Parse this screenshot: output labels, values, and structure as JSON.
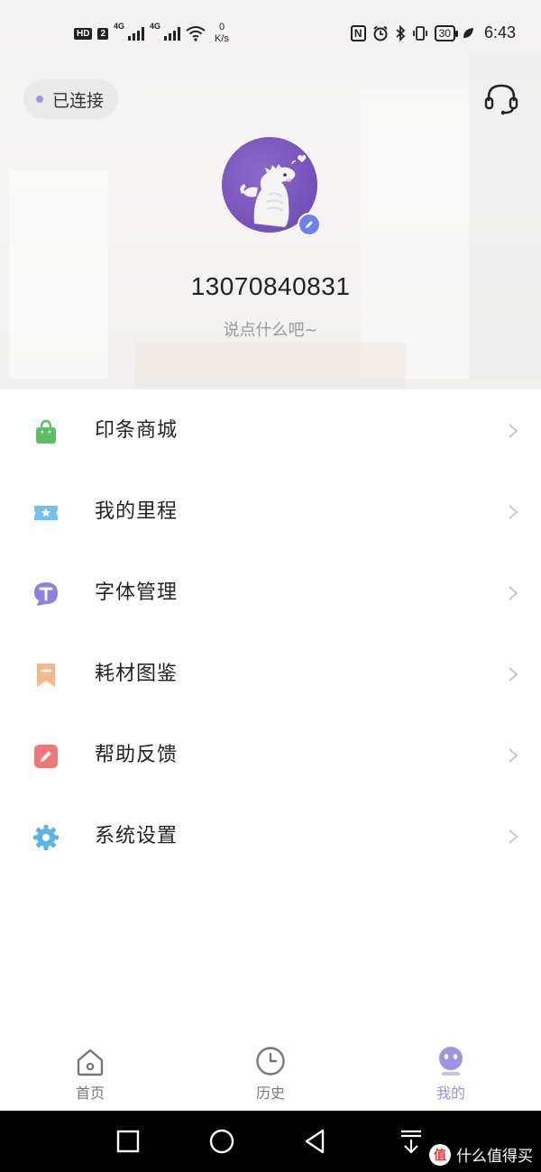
{
  "status_bar": {
    "hd_badge": "HD",
    "sim_number": "2",
    "net1": "4G",
    "net2": "4G",
    "speed_value": "0",
    "speed_unit": "K/s",
    "nfc_glyph": "N",
    "battery": "30",
    "time": "6:43"
  },
  "header": {
    "connection_label": "已连接",
    "support_icon": "headset-icon"
  },
  "profile": {
    "username": "13070840831",
    "bio": "说点什么吧~",
    "avatar_icon": "crocodile-avatar"
  },
  "menu": {
    "items": [
      {
        "label": "印条商城",
        "icon": "shopping-bag-icon",
        "color": "#5fbf67"
      },
      {
        "label": "我的里程",
        "icon": "ticket-star-icon",
        "color": "#6fc3ee"
      },
      {
        "label": "字体管理",
        "icon": "font-t-icon",
        "color": "#8f7fe0"
      },
      {
        "label": "耗材图鉴",
        "icon": "bookmark-icon",
        "color": "#f3b98a"
      },
      {
        "label": "帮助反馈",
        "icon": "edit-pencil-icon",
        "color": "#f07878"
      },
      {
        "label": "系统设置",
        "icon": "gear-icon",
        "color": "#5db3e8"
      }
    ]
  },
  "tabbar": {
    "tabs": [
      {
        "label": "首页",
        "icon": "home-icon"
      },
      {
        "label": "历史",
        "icon": "clock-icon"
      },
      {
        "label": "我的",
        "icon": "profile-face-icon"
      }
    ],
    "active_color": "#9d90dc"
  },
  "watermark": {
    "logo": "值",
    "text": "什么值得买"
  }
}
